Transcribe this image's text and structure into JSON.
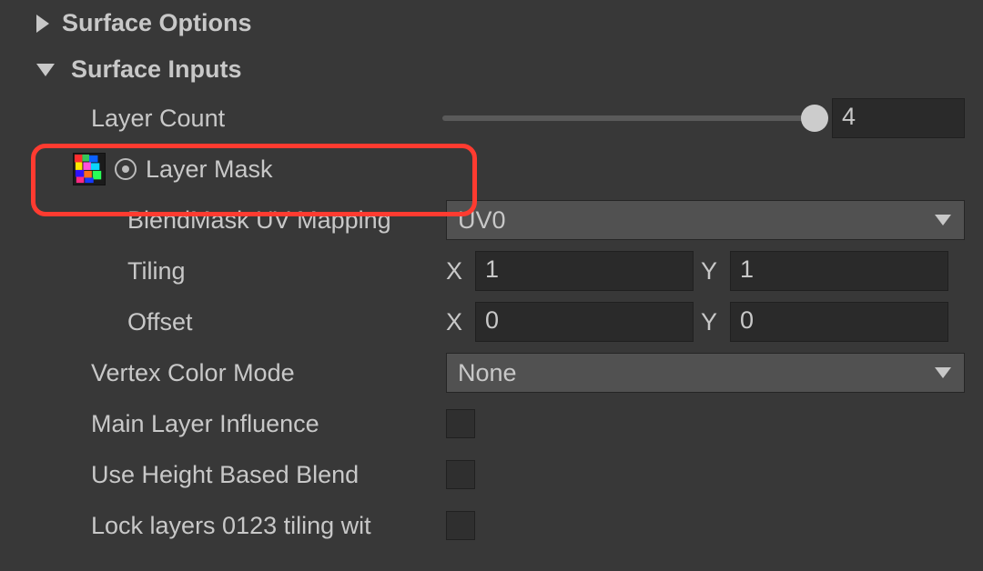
{
  "sections": {
    "surface_options": {
      "title": "Surface Options",
      "expanded": false
    },
    "surface_inputs": {
      "title": "Surface Inputs",
      "expanded": true
    }
  },
  "layer_count": {
    "label": "Layer Count",
    "value": "4"
  },
  "layer_mask": {
    "label": "Layer Mask"
  },
  "blendmask_uv": {
    "label": "BlendMask UV Mapping",
    "selected": "UV0"
  },
  "tiling": {
    "label": "Tiling",
    "x_label": "X",
    "x": "1",
    "y_label": "Y",
    "y": "1"
  },
  "offset": {
    "label": "Offset",
    "x_label": "X",
    "x": "0",
    "y_label": "Y",
    "y": "0"
  },
  "vertex_color_mode": {
    "label": "Vertex Color Mode",
    "selected": "None"
  },
  "main_layer_influence": {
    "label": "Main Layer Influence",
    "checked": false
  },
  "use_height_based_blend": {
    "label": "Use Height Based Blend",
    "checked": false
  },
  "lock_layers": {
    "label": "Lock layers 0123 tiling wit",
    "checked": false
  }
}
